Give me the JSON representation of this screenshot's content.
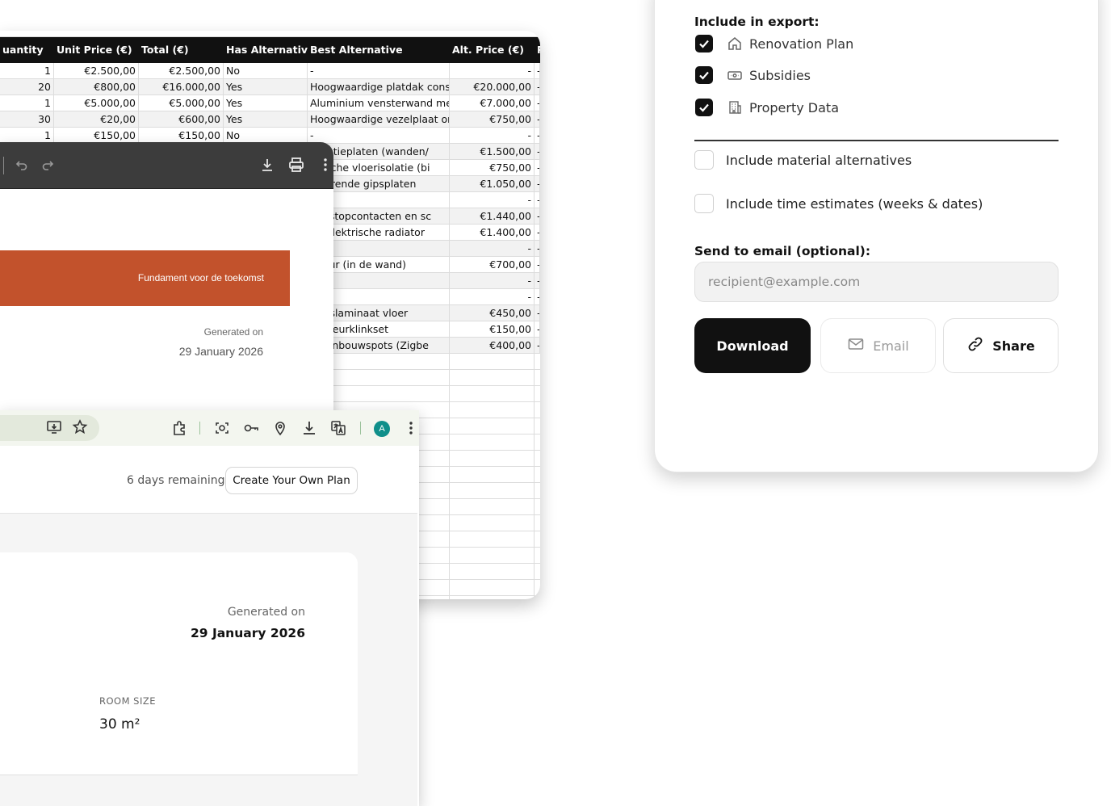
{
  "spreadsheet": {
    "headers": [
      "uantity",
      "Unit Price (€)",
      "Total (€)",
      "Has Alternatives",
      "Best Alternative",
      "Alt. Price (€)",
      "P"
    ],
    "rows": [
      [
        "1",
        "€2.500,00",
        "€2.500,00",
        "No",
        "-",
        "-",
        "-"
      ],
      [
        "20",
        "€800,00",
        "€16.000,00",
        "Yes",
        "Hoogwaardige platdak const",
        "€20.000,00",
        "-"
      ],
      [
        "1",
        "€5.000,00",
        "€5.000,00",
        "Yes",
        "Aluminium vensterwand me",
        "€7.000,00",
        "-"
      ],
      [
        "30",
        "€20,00",
        "€600,00",
        "Yes",
        "Hoogwaardige vezelplaat or",
        "€750,00",
        "-"
      ],
      [
        "1",
        "€150,00",
        "€150,00",
        "No",
        "-",
        "-",
        "-"
      ],
      [
        "",
        "",
        "",
        "",
        "isolatieplaten (wanden/",
        "€1.500,00",
        "-"
      ],
      [
        "",
        "",
        "",
        "",
        "ogische vloerisolatie (bi",
        "€750,00",
        "-"
      ],
      [
        "",
        "",
        "",
        "",
        "dwerende gipsplaten",
        "€1.050,00",
        "-"
      ],
      [
        "",
        "",
        "",
        "",
        "",
        "-",
        "-"
      ],
      [
        "",
        "",
        "",
        "",
        "me stopcontacten en sc",
        "€1.440,00",
        "-"
      ],
      [
        "",
        "",
        "",
        "",
        "gn elektrische radiator",
        "€1.400,00",
        "-"
      ],
      [
        "",
        "",
        "",
        "",
        "",
        "-",
        "-"
      ],
      [
        "",
        "",
        "",
        "",
        "ifdeur (in de wand)",
        "€700,00",
        "-"
      ],
      [
        "",
        "",
        "",
        "",
        "",
        "-",
        "-"
      ],
      [
        "",
        "",
        "",
        "",
        "",
        "-",
        "-"
      ],
      [
        "",
        "",
        "",
        "",
        "iteitslaminaat vloer",
        "€450,00",
        "-"
      ],
      [
        "",
        "",
        "",
        "",
        "gn deurklinkset",
        "€150,00",
        "-"
      ],
      [
        "",
        "",
        "",
        "",
        "me inbouwspots (Zigbe",
        "€400,00",
        "-"
      ]
    ]
  },
  "pdf_viewer": {
    "banner_text": "Fundament voor de toekomst",
    "generated_label": "Generated on",
    "generated_date": "29 January 2026",
    "icons": [
      "undo-icon",
      "redo-icon",
      "download-icon",
      "print-icon",
      "more-icon"
    ]
  },
  "browser": {
    "avatar_letter": "A",
    "days_remaining": "6 days remaining",
    "create_plan_button": "Create Your Own Plan",
    "generated_label": "Generated on",
    "generated_date": "29 January 2026",
    "room_size_label": "ROOM SIZE",
    "room_size_value": "30 m²"
  },
  "export_panel": {
    "include_heading": "Include in export:",
    "export_options": [
      {
        "label": "Renovation Plan",
        "icon": "home-icon",
        "checked": true
      },
      {
        "label": "Subsidies",
        "icon": "banknote-icon",
        "checked": true
      },
      {
        "label": "Property Data",
        "icon": "building-icon",
        "checked": true
      }
    ],
    "extra_options": [
      {
        "label": "Include material alternatives",
        "checked": false
      },
      {
        "label": "Include time estimates (weeks & dates)",
        "checked": false
      }
    ],
    "email_label": "Send to email (optional):",
    "email_placeholder": "recipient@example.com",
    "download_button": "Download",
    "email_button": "Email",
    "share_button": "Share",
    "accent_color": "#111111"
  }
}
